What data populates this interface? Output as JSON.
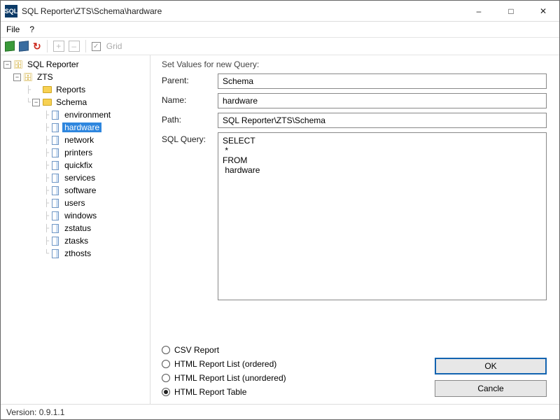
{
  "window": {
    "title": "SQL Reporter\\ZTS\\Schema\\hardware",
    "icon_text": "SQL"
  },
  "menubar": {
    "items": [
      "File",
      "?"
    ]
  },
  "toolbar": {
    "grid_label": "Grid"
  },
  "tree": {
    "root": "SQL Reporter",
    "db": "ZTS",
    "folders": [
      "Reports",
      "Schema"
    ],
    "schema_items": [
      "environment",
      "hardware",
      "network",
      "printers",
      "quickfix",
      "services",
      "software",
      "users",
      "windows",
      "zstatus",
      "ztasks",
      "zthosts"
    ],
    "selected": "hardware"
  },
  "form": {
    "section_title": "Set Values for new Query:",
    "labels": {
      "parent": "Parent:",
      "name": "Name:",
      "path": "Path:",
      "sql": "SQL Query:"
    },
    "values": {
      "parent": "Schema",
      "name": "hardware",
      "path": "SQL Reporter\\ZTS\\Schema",
      "sql": "SELECT\n *\nFROM\n hardware"
    }
  },
  "radios": [
    {
      "label": "CSV  Report",
      "checked": false
    },
    {
      "label": "HTML Report List (ordered)",
      "checked": false
    },
    {
      "label": "HTML Report List (unordered)",
      "checked": false
    },
    {
      "label": "HTML Report Table",
      "checked": true
    }
  ],
  "buttons": {
    "ok": "OK",
    "cancel": "Cancle"
  },
  "status": {
    "version_label": "Version: 0.9.1.1"
  }
}
